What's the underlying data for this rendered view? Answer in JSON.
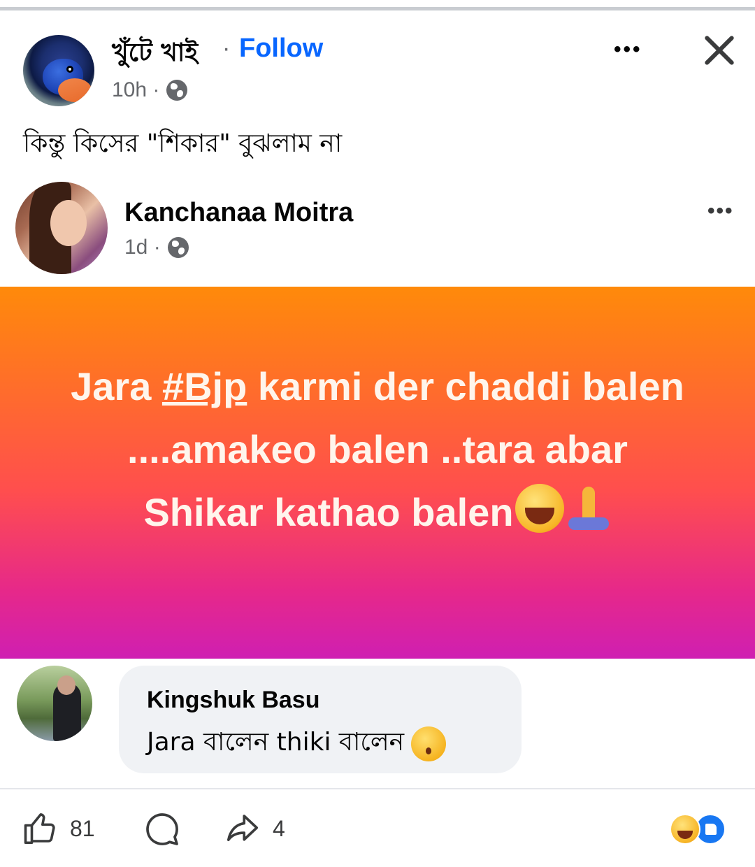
{
  "post": {
    "author": "খুঁটে খাই",
    "separator": "·",
    "follow_label": "Follow",
    "time": "10h ·",
    "caption": "কিন্তু কিসের \"শিকার\" বুঝলাম না"
  },
  "shared_post": {
    "author": "Kanchanaa Moitra",
    "time": "1d ·",
    "text": {
      "line1_prefix": "Jara ",
      "hashtag": "#Bjp",
      "line1_suffix": " karmi der chaddi balen",
      "line2": "....amakeo balen ..tara abar",
      "line3": "Shikar kathao balen"
    },
    "background_colors": [
      "#ff8a0a",
      "#ff4e4e",
      "#cf1fb2"
    ]
  },
  "comment": {
    "author": "Kingshuk Basu",
    "text": "Jara বালেন thiki বালেন"
  },
  "actions": {
    "like_count": "81",
    "share_count": "4"
  },
  "colors": {
    "accent": "#0866ff",
    "text_secondary": "#65676b"
  },
  "icons": {
    "more": "more-horizontal-icon",
    "close": "close-icon",
    "privacy": "globe-icon",
    "like": "thumbs-up-icon",
    "comment": "comment-icon",
    "share": "share-icon"
  }
}
